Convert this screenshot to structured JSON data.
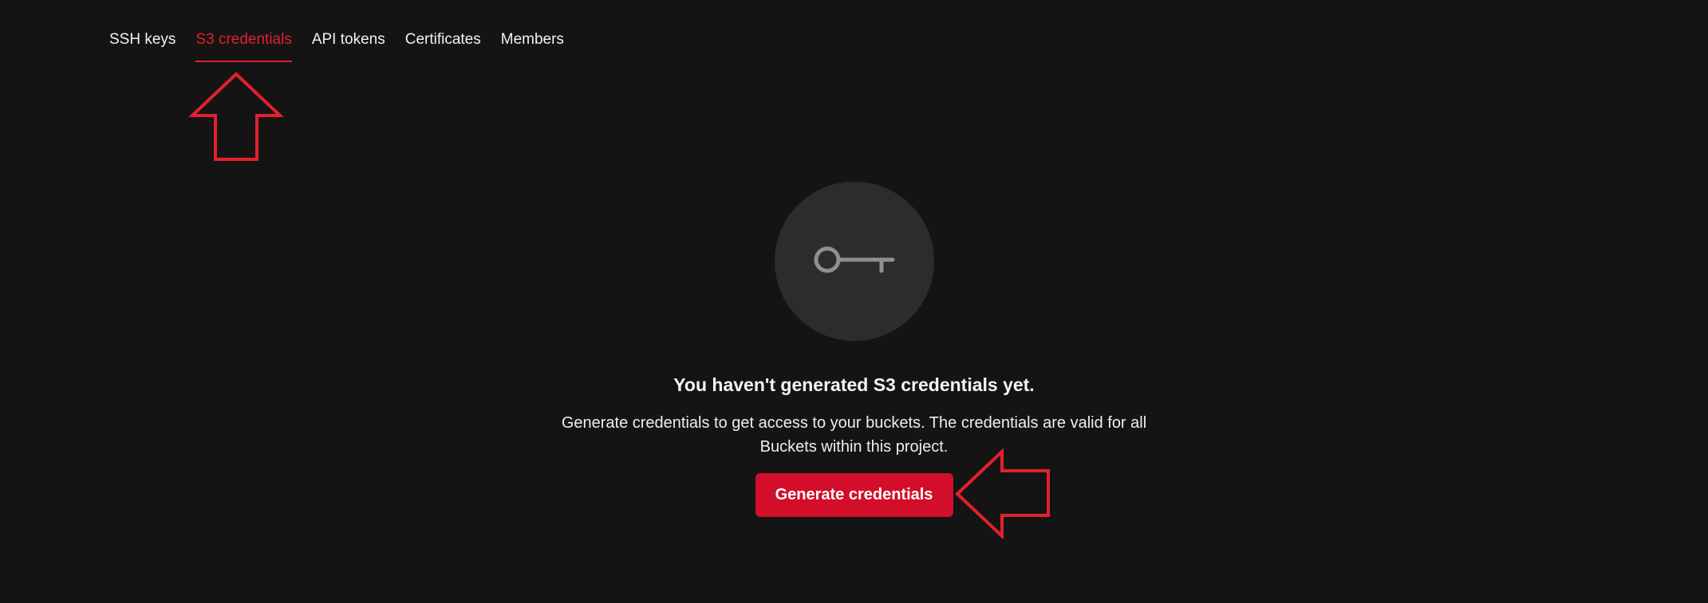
{
  "tabs": [
    {
      "label": "SSH keys",
      "active": false
    },
    {
      "label": "S3 credentials",
      "active": true
    },
    {
      "label": "API tokens",
      "active": false
    },
    {
      "label": "Certificates",
      "active": false
    },
    {
      "label": "Members",
      "active": false
    }
  ],
  "empty_state": {
    "icon": "key-icon",
    "title": "You haven't generated S3 credentials yet.",
    "description": "Generate credentials to get access to your buckets. The credentials are valid for all Buckets within this project.",
    "button_label": "Generate credentials"
  },
  "colors": {
    "background": "#141414",
    "accent": "#e2202e",
    "button": "#d30e2a",
    "icon_circle": "#2c2c2c",
    "icon": "#8f8f8f"
  }
}
